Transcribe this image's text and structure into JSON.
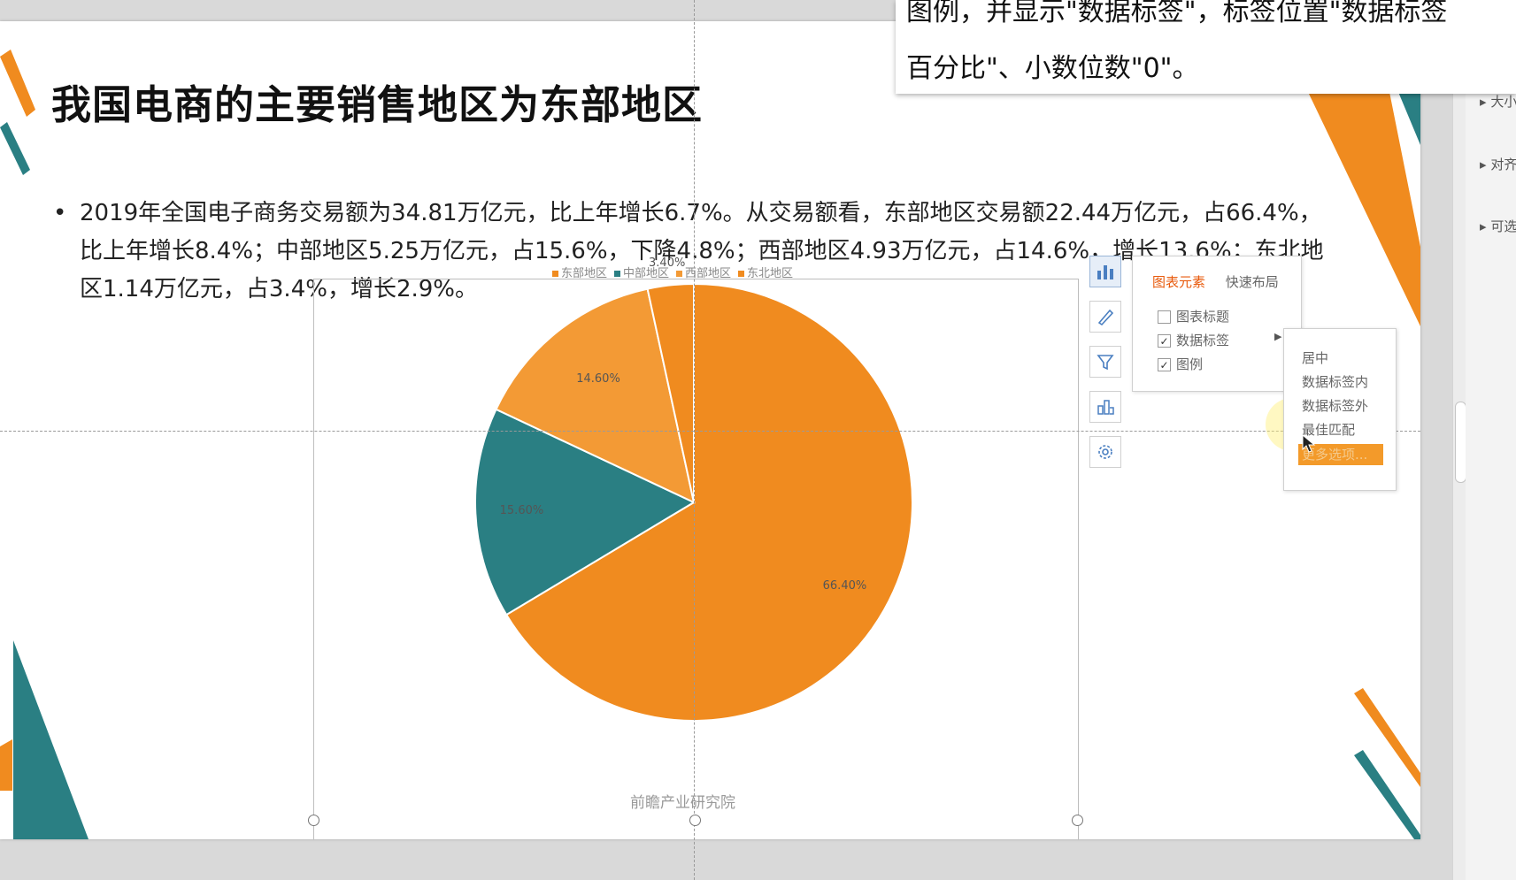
{
  "slide": {
    "title": "我国电商的主要销售地区为东部地区",
    "bullet_marker": "•",
    "bullet_text": "2019年全国电子商务交易额为34.81万亿元，比上年增长6.7%。从交易额看，东部地区交易额22.44万亿元，占66.4%，比上年增长8.4%；中部地区5.25万亿元，占15.6%，下降4.8%；西部地区4.93万亿元，占14.6%，增长13.6%；东北地区1.14万亿元，占3.4%，增长2.9%。",
    "source": "前瞻产业研究院"
  },
  "chart_data": {
    "type": "pie",
    "categories": [
      "东部地区",
      "中部地区",
      "西部地区",
      "东北地区"
    ],
    "values": [
      66.4,
      15.6,
      14.6,
      3.4
    ],
    "data_labels": [
      "66.40%",
      "15.60%",
      "14.60%",
      "3.40%"
    ],
    "colors": [
      "#f08b1f",
      "#2a7f83",
      "#f39a35",
      "#f08b1f"
    ],
    "legend_position": "top",
    "start_angle_deg": 0,
    "direction": "clockwise",
    "source": "前瞻产业研究院"
  },
  "chart_toolbar": {
    "icons": [
      "chart-elements-icon",
      "chart-style-icon",
      "chart-filter-icon",
      "chart-type-icon",
      "chart-settings-icon"
    ]
  },
  "chart_elements_panel": {
    "tab_elements": "图表元素",
    "tab_layout": "快速布局",
    "options": [
      {
        "label": "图表标题",
        "checked": false
      },
      {
        "label": "数据标签",
        "checked": true
      },
      {
        "label": "图例",
        "checked": true
      }
    ],
    "check_mark": "✓",
    "arrow": "▶"
  },
  "label_position_menu": {
    "items": [
      "居中",
      "数据标签内",
      "数据标签外",
      "最佳匹配",
      "更多选项..."
    ],
    "highlighted_index": 4
  },
  "instruction": {
    "line1": "图例，并显示\"数据标签\"，标签位置\"数据标签",
    "line2": "百分比\"、小数位数\"0\"。"
  },
  "right_panel": {
    "items": [
      "大小",
      "对齐",
      "可选"
    ]
  },
  "accent_colors": {
    "orange": "#f08b1f",
    "teal": "#2a7f83"
  }
}
